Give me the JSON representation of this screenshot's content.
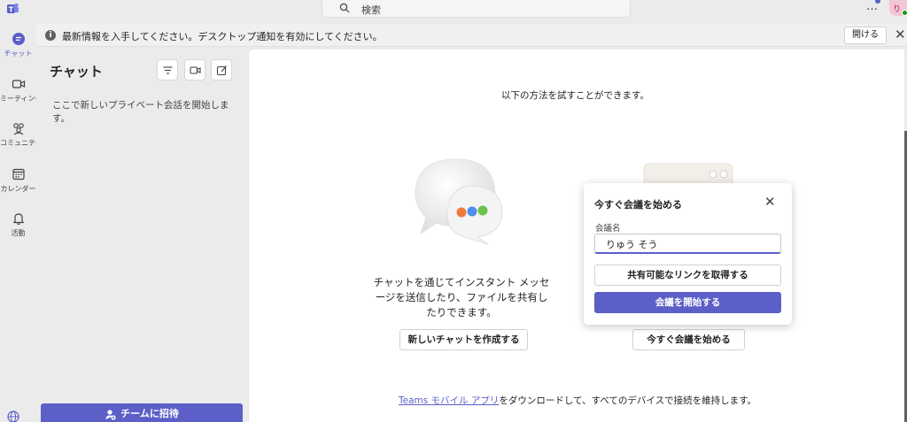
{
  "colors": {
    "accent": "#5b5fc7",
    "rail_bg": "#ebebeb",
    "presence": "#13a10e"
  },
  "search": {
    "placeholder": "検索"
  },
  "topbar": {
    "more": "…",
    "avatar_initials": "りそ"
  },
  "rail": {
    "items": [
      {
        "label": "チャット",
        "icon": "chat-icon"
      },
      {
        "label": "ミーティング",
        "icon": "video-icon"
      },
      {
        "label": "コミュニティ",
        "icon": "people-icon"
      },
      {
        "label": "カレンダー",
        "icon": "calendar-icon"
      },
      {
        "label": "活動",
        "icon": "bell-icon"
      }
    ]
  },
  "banner": {
    "text": "最新情報を入手してください。デスクトップ通知を有効にしてください。",
    "open_label": "開ける",
    "close": "✕"
  },
  "chat_pane": {
    "title": "チャット",
    "empty_text": "ここで新しいプライベート会話を開始します。",
    "invite_label": "チームに招待"
  },
  "main": {
    "subtitle": "以下の方法を試すことができます。",
    "chat_description": "チャットを通じてインスタント メッセージを送信したり、ファイルを共有したりできます。",
    "new_chat_label": "新しいチャットを作成する",
    "meet_now_label": "今すぐ会議を始める",
    "footer_link": "Teams モバイル アプリ",
    "footer_text": "をダウンロードして、すべてのデバイスで接続を維持します。"
  },
  "popup": {
    "title": "今すぐ会議を始める",
    "close": "✕",
    "name_label": "会議名",
    "name_value": "りゅう そう",
    "link_label": "共有可能なリンクを取得する",
    "start_label": "会議を開始する"
  }
}
